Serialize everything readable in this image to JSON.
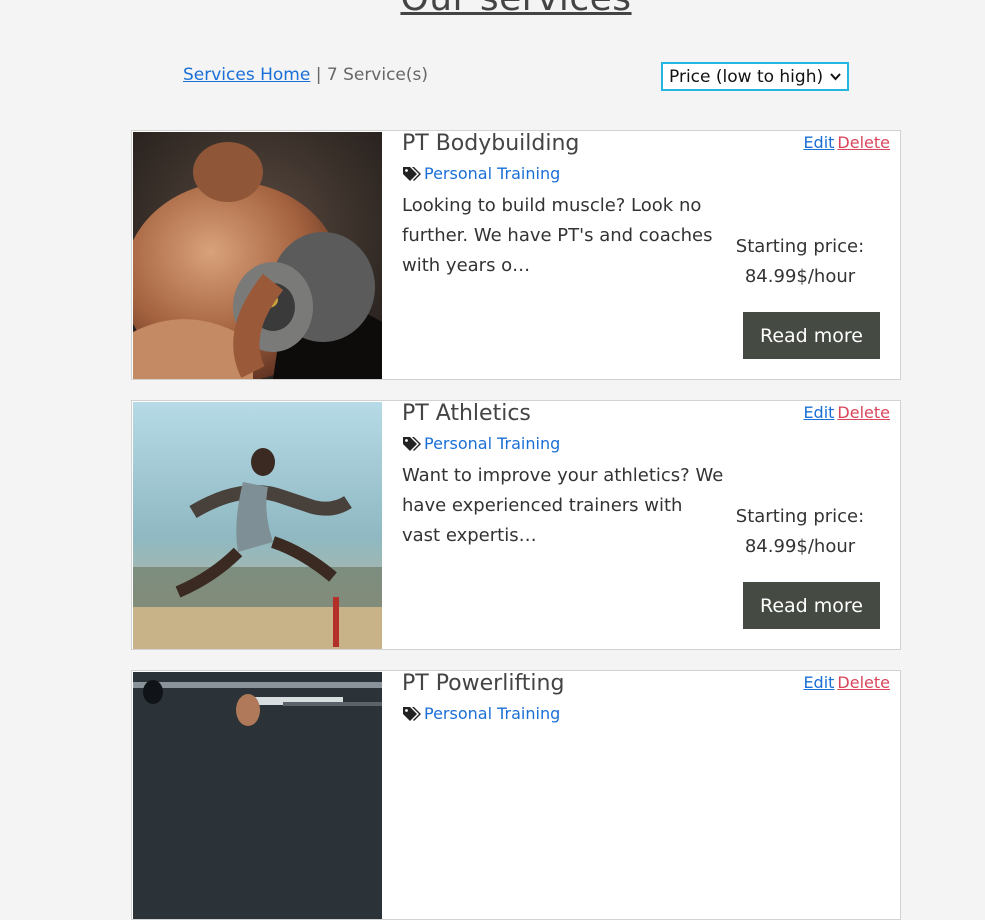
{
  "page": {
    "title": "Our services"
  },
  "toolbar": {
    "home_link": "Services Home",
    "separator": " | ",
    "count_text": "7 Service(s)",
    "sort_selected": "Price (low to high)"
  },
  "services": [
    {
      "title": "PT Bodybuilding",
      "category": "Personal Training",
      "description": "Looking to build muscle? Look no further. We have PT's and coaches with years o…",
      "price_label": "Starting price:",
      "price": "84.99$/hour",
      "read_more": "Read more",
      "edit": "Edit",
      "delete": "Delete"
    },
    {
      "title": "PT Athletics",
      "category": "Personal Training",
      "description": "Want to improve your athletics? We have experienced trainers with vast expertis…",
      "price_label": "Starting price:",
      "price": "84.99$/hour",
      "read_more": "Read more",
      "edit": "Edit",
      "delete": "Delete"
    },
    {
      "title": "PT Powerlifting",
      "category": "Personal Training",
      "description": "",
      "price_label": "",
      "price": "",
      "read_more": "",
      "edit": "Edit",
      "delete": "Delete"
    }
  ],
  "colors": {
    "link": "#1a6fd6",
    "delete": "#d9455b",
    "button_bg": "#454a43",
    "select_border": "#22b6e0"
  }
}
